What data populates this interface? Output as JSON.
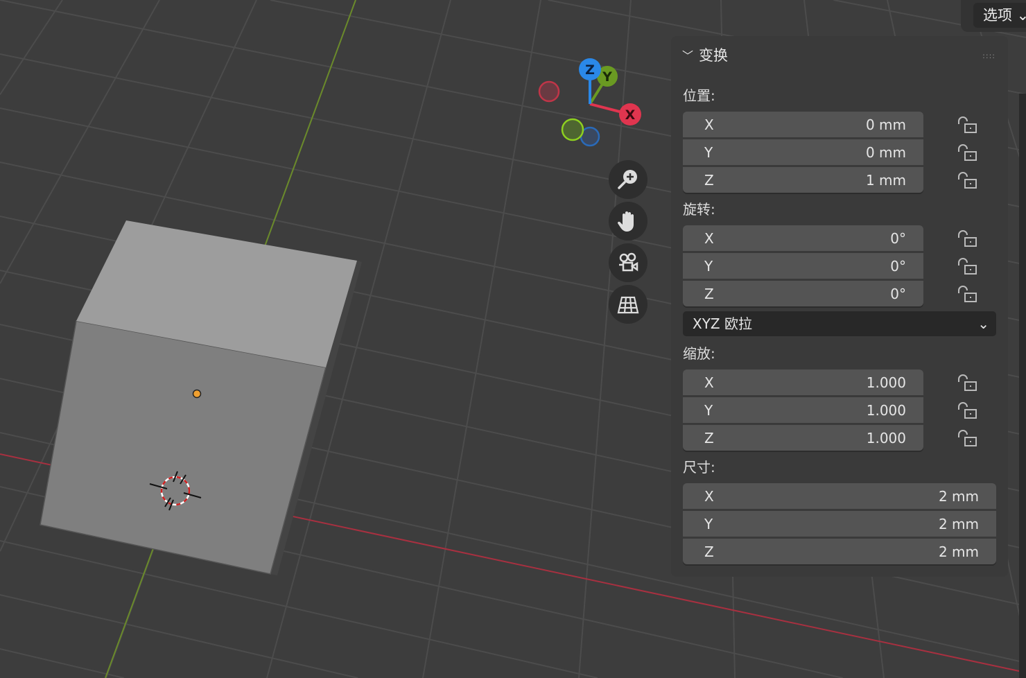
{
  "header_button": {
    "label": "选项"
  },
  "panel": {
    "title": "变换",
    "location": {
      "label": "位置:",
      "x": "0 mm",
      "y": "0 mm",
      "z": "1 mm"
    },
    "rotation": {
      "label": "旋转:",
      "x": "0°",
      "y": "0°",
      "z": "0°"
    },
    "rotation_mode": "XYZ 欧拉",
    "scale": {
      "label": "缩放:",
      "x": "1.000",
      "y": "1.000",
      "z": "1.000"
    },
    "dimensions": {
      "label": "尺寸:",
      "x": "2 mm",
      "y": "2 mm",
      "z": "2 mm"
    },
    "axis_x": "X",
    "axis_y": "Y",
    "axis_z": "Z"
  },
  "gizmo": {
    "x": "X",
    "y": "Y",
    "z": "Z"
  },
  "colors": {
    "x_axis": "#e0354f",
    "y_axis": "#6a9a22",
    "z_axis": "#2a88e8",
    "origin": "#f0a030"
  }
}
